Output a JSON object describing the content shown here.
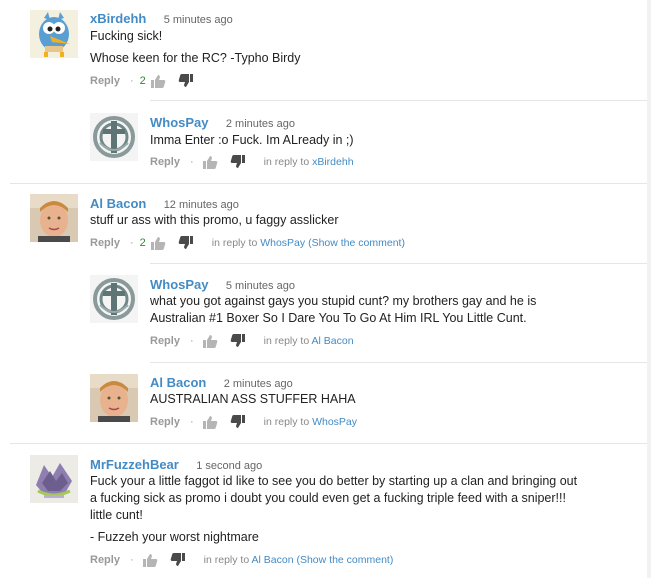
{
  "comments": [
    {
      "author": "xBirdehh",
      "time": "5 minutes ago",
      "lines": [
        "Fucking sick!",
        "Whose keen for the RC? -Typho Birdy"
      ],
      "reply_label": "Reply",
      "dot": "·",
      "likes": "2"
    },
    {
      "author": "WhosPay",
      "time": "2 minutes ago",
      "lines": [
        "Imma Enter :o Fuck. Im ALready in ;)"
      ],
      "reply_label": "Reply",
      "dot": "·",
      "in_reply_prefix": "in reply to",
      "in_reply_to": "xBirdehh"
    },
    {
      "author": "Al Bacon",
      "time": "12 minutes ago",
      "lines": [
        "stuff ur ass with this promo, u faggy asslicker"
      ],
      "reply_label": "Reply",
      "dot": "·",
      "likes": "2",
      "in_reply_prefix": "in reply to",
      "in_reply_to": "WhosPay",
      "show_comment": "(Show the comment)"
    },
    {
      "author": "WhosPay",
      "time": "5 minutes ago",
      "lines": [
        "what you got against gays you stupid cunt? my brothers gay and he is",
        "Australian #1 Boxer So I Dare You To Go At Him IRL You Little Cunt."
      ],
      "reply_label": "Reply",
      "dot": "·",
      "in_reply_prefix": "in reply to",
      "in_reply_to": "Al Bacon"
    },
    {
      "author": "Al Bacon",
      "time": "2 minutes ago",
      "lines": [
        "AUSTRALIAN ASS STUFFER HAHA"
      ],
      "reply_label": "Reply",
      "dot": "·",
      "in_reply_prefix": "in reply to",
      "in_reply_to": "WhosPay"
    },
    {
      "author": "MrFuzzehBear",
      "time": "1 second ago",
      "lines": [
        "Fuck your a little faggot id like to see you do better by starting up a clan and bringing out",
        "a fucking sick as promo i doubt you could even get a fucking triple feed with a sniper!!!",
        "little cunt!",
        "- Fuzzeh your worst nightmare"
      ],
      "reply_label": "Reply",
      "dot": "·",
      "in_reply_prefix": "in reply to",
      "in_reply_to": "Al Bacon",
      "show_comment": "(Show the comment)"
    }
  ],
  "colors": {
    "author": "#438bc5",
    "likes": "#2e8b2e",
    "muted": "#999999"
  },
  "icons": [
    "thumbs-up-icon",
    "thumbs-down-icon",
    "bird-avatar",
    "tribal-logo-avatar",
    "photo-avatar",
    "graffiti-avatar"
  ]
}
